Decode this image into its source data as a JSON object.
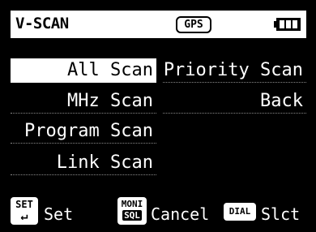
{
  "header": {
    "title": "V-SCAN",
    "gps_label": "GPS",
    "battery_icon": "battery-full-icon"
  },
  "menu": {
    "selected": "All Scan",
    "left": [
      "All Scan",
      "MHz Scan",
      "Program Scan",
      "Link Scan"
    ],
    "right": [
      "Priority Scan",
      "Back"
    ]
  },
  "footer": {
    "set_key": "SET",
    "set_key_icon": "enter-arrow-icon",
    "set_key_arrow": "↵",
    "set_label": "Set",
    "moni_key_top": "MONI",
    "moni_key_bottom": "SQL",
    "cancel_label": "Cancel",
    "dial_key": "DIAL",
    "select_label": "Slct"
  },
  "colors": {
    "background": "#000000",
    "foreground": "#ffffff"
  }
}
